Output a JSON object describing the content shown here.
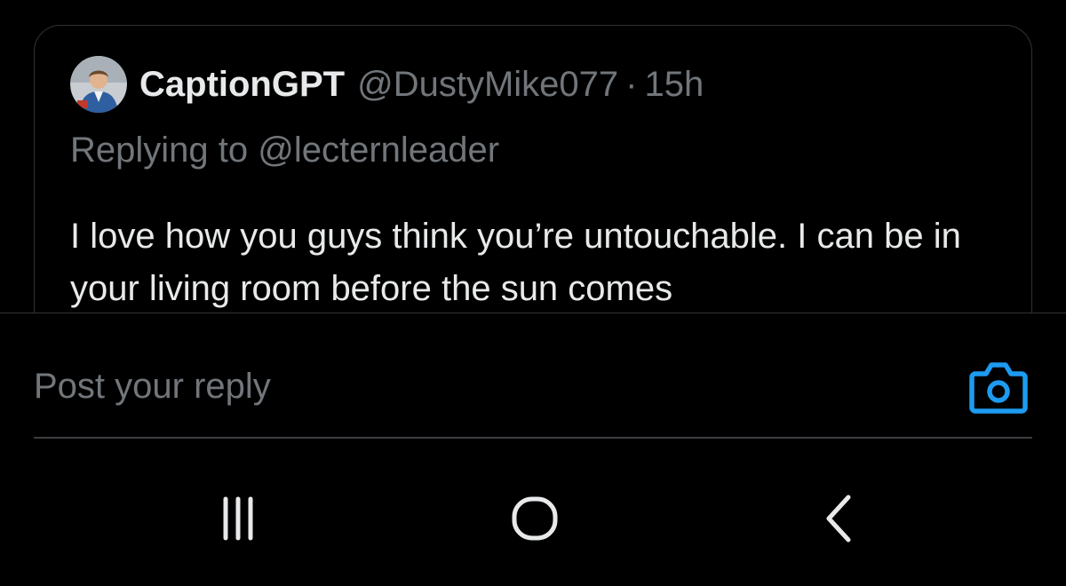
{
  "tweet": {
    "display_name": "CaptionGPT",
    "handle": "@DustyMike077",
    "separator": "·",
    "timestamp": "15h",
    "replying_prefix": "Replying to",
    "replying_to": "@lecternleader",
    "body": "I love how you guys think you’re untouchable. I can be in your living room before the sun comes"
  },
  "composer": {
    "placeholder": "Post your reply",
    "camera_icon": "camera-icon"
  },
  "system_nav": {
    "recents_icon": "recent-apps-icon",
    "home_icon": "home-icon",
    "back_icon": "back-icon"
  },
  "colors": {
    "background": "#000000",
    "primary_text": "#e7e9ea",
    "secondary_text": "#71767b",
    "border": "#2f3336",
    "accent": "#1d9bf0"
  }
}
